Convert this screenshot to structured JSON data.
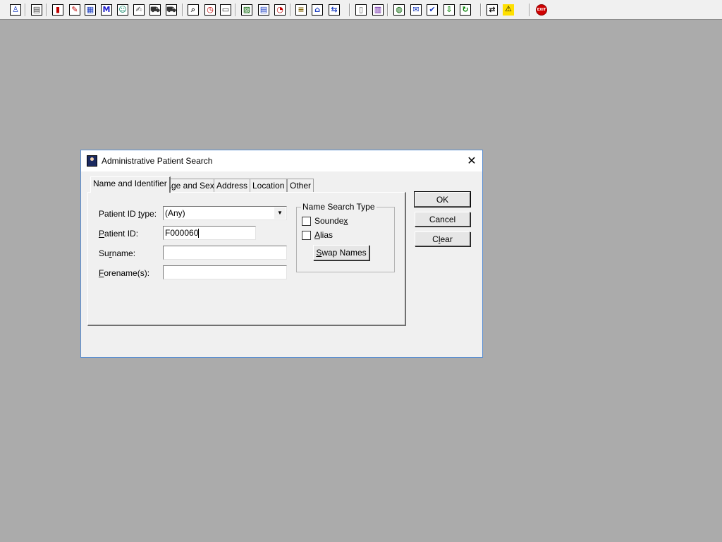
{
  "toolbar": {
    "buttons": [
      {
        "name": "patient-icon",
        "glyph": "♙",
        "color": "#1a3cc0"
      },
      {
        "name": "print-icon",
        "glyph": "▤",
        "color": "#444"
      },
      {
        "name": "book-icon",
        "glyph": "▮",
        "color": "#c00000"
      },
      {
        "name": "edit-record-icon",
        "glyph": "✎",
        "color": "#c00000"
      },
      {
        "name": "document-icon",
        "glyph": "▦",
        "color": "#1a3cc0"
      },
      {
        "name": "letter-m-icon",
        "glyph": "M",
        "color": "#1a1acc"
      },
      {
        "name": "person-icon",
        "glyph": "☺",
        "color": "#008060"
      },
      {
        "name": "notes-icon",
        "glyph": "✍",
        "color": "#555"
      },
      {
        "name": "ambulance-icon",
        "glyph": "⛟",
        "color": "#333"
      },
      {
        "name": "vehicle-icon",
        "glyph": "⛟",
        "color": "#333"
      },
      {
        "name": "search-document-icon",
        "glyph": "⌕",
        "color": "#333"
      },
      {
        "name": "clock-icon",
        "glyph": "◷",
        "color": "#c00000"
      },
      {
        "name": "display-icon",
        "glyph": "▭",
        "color": "#333"
      },
      {
        "name": "chart-icon",
        "glyph": "▨",
        "color": "#006000"
      },
      {
        "name": "form-icon",
        "glyph": "▤",
        "color": "#1a3cc0"
      },
      {
        "name": "gauge-icon",
        "glyph": "◔",
        "color": "#c00000"
      },
      {
        "name": "list-icon",
        "glyph": "≡",
        "color": "#806000"
      },
      {
        "name": "bed-icon",
        "glyph": "⌂",
        "color": "#1a3cc0"
      },
      {
        "name": "transfer-icon",
        "glyph": "⇆",
        "color": "#1a3cc0"
      },
      {
        "name": "page-icon",
        "glyph": "▯",
        "color": "#555"
      },
      {
        "name": "bar-chart-icon",
        "glyph": "▥",
        "color": "#6010a0"
      },
      {
        "name": "globe-icon",
        "glyph": "◍",
        "color": "#006000"
      },
      {
        "name": "messages-icon",
        "glyph": "✉",
        "color": "#1a3cc0"
      },
      {
        "name": "approve-icon",
        "glyph": "✔",
        "color": "#1a3cc0"
      },
      {
        "name": "download-icon",
        "glyph": "⇩",
        "color": "#008000"
      },
      {
        "name": "refresh-icon",
        "glyph": "↻",
        "color": "#008000"
      },
      {
        "name": "swap-arrows-icon",
        "glyph": "⇄",
        "color": "#000"
      },
      {
        "name": "warning-icon",
        "glyph": "⚠",
        "color": "#000"
      },
      {
        "name": "exit-icon",
        "glyph": "EXIT",
        "color": "#ffffff"
      }
    ]
  },
  "dialog": {
    "title": "Administrative Patient Search",
    "close_glyph": "✕",
    "tabs": [
      {
        "label": "Name and Identifier",
        "active": true
      },
      {
        "label": "Age and Sex",
        "active": false
      },
      {
        "label": "Address",
        "active": false
      },
      {
        "label": "Location",
        "active": false
      },
      {
        "label": "Other",
        "active": false
      }
    ],
    "fields": {
      "patient_id_type": {
        "label_pre": "Patient ID ",
        "label_u": "t",
        "label_post": "ype:",
        "value": "(Any)"
      },
      "patient_id": {
        "label_pre": "",
        "label_u": "P",
        "label_post": "atient ID:",
        "value": "F000060"
      },
      "surname": {
        "label_pre": "Su",
        "label_u": "r",
        "label_post": "name:",
        "value": ""
      },
      "forename": {
        "label_pre": "",
        "label_u": "F",
        "label_post": "orename(s):",
        "value": ""
      }
    },
    "name_search_type": {
      "legend": "Name Search Type",
      "soundex": {
        "label_pre": "Sounde",
        "label_u": "x",
        "label_post": "",
        "checked": false
      },
      "alias": {
        "label_pre": "",
        "label_u": "A",
        "label_post": "lias",
        "checked": false
      },
      "swap_button": {
        "label_pre": "",
        "label_u": "S",
        "label_post": "wap Names"
      }
    },
    "buttons": {
      "ok": "OK",
      "cancel": "Cancel",
      "clear_pre": "C",
      "clear_u": "l",
      "clear_post": "ear"
    }
  }
}
